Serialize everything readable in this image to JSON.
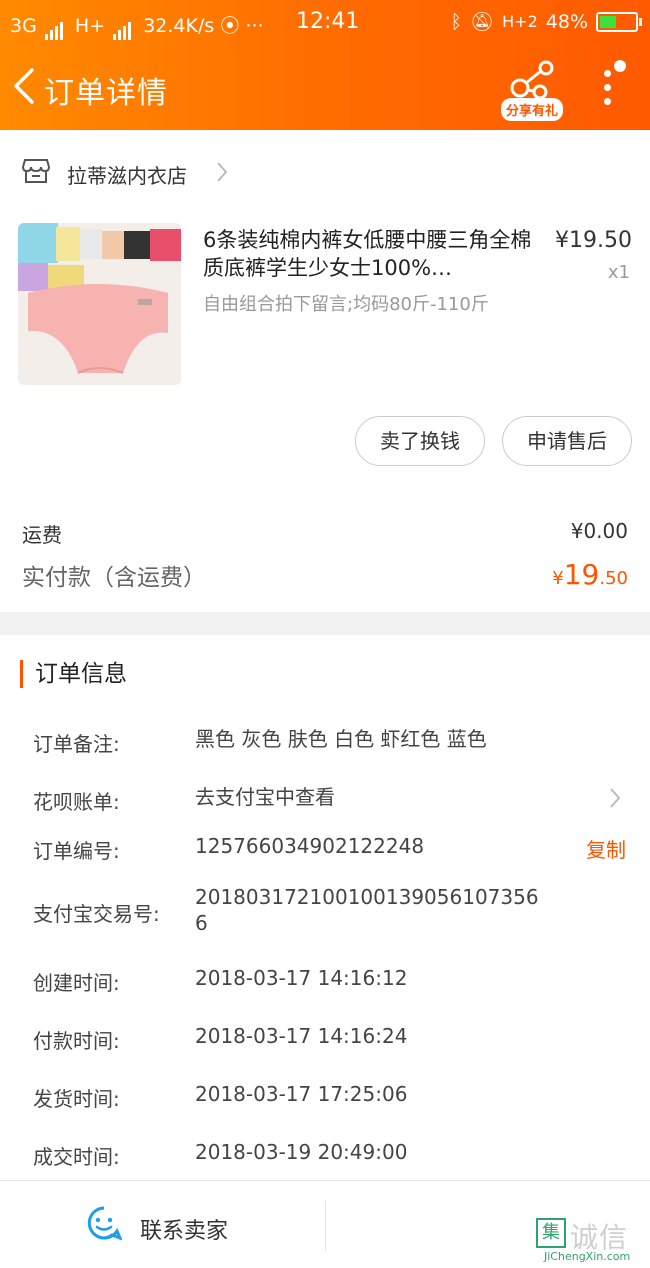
{
  "status_bar": {
    "network1": "3G",
    "network2": "H+",
    "speed": "32.4K/s",
    "time": "12:41",
    "network3": "H+2",
    "battery": "48%",
    "battery_level": 0.48
  },
  "nav": {
    "title": "订单详情",
    "share_badge": "分享有礼"
  },
  "shop": {
    "name": "拉蒂滋内衣店"
  },
  "product": {
    "title": "6条装纯棉内裤女低腰中腰三角全棉质底裤学生少女士100%…",
    "sku": "自由组合拍下留言;均码80斤-110斤",
    "price": "¥19.50",
    "quantity": "x1"
  },
  "actions": {
    "sell_button": "卖了换钱",
    "after_sale_button": "申请售后"
  },
  "fees": {
    "shipping_label": "运费",
    "shipping_value": "¥0.00",
    "total_label": "实付款（含运费）",
    "total_currency": "¥",
    "total_integer": "19",
    "total_decimal": ".50"
  },
  "order_info": {
    "section_title": "订单信息",
    "rows": [
      {
        "label": "订单备注:",
        "value": "黑色 灰色 肤色 白色 虾红色 蓝色"
      },
      {
        "label": "花呗账单:",
        "value": "去支付宝中查看"
      },
      {
        "label": "订单编号:",
        "value": "125766034902122248"
      },
      {
        "label": "支付宝交易号:",
        "value": "2018031721001001390561073566"
      },
      {
        "label": "创建时间:",
        "value": "2018-03-17 14:16:12"
      },
      {
        "label": "付款时间:",
        "value": "2018-03-17 14:16:24"
      },
      {
        "label": "发货时间:",
        "value": "2018-03-17 17:25:06"
      },
      {
        "label": "成交时间:",
        "value": "2018-03-19 20:49:00"
      }
    ],
    "copy_label": "复制"
  },
  "bottom_bar": {
    "contact_label": "联系卖家"
  },
  "watermark": {
    "logo": "集",
    "brand": "诚信",
    "url": "JiChengXin.com"
  },
  "colors": {
    "accent": "#ff5500",
    "header": "#ff7a00"
  }
}
